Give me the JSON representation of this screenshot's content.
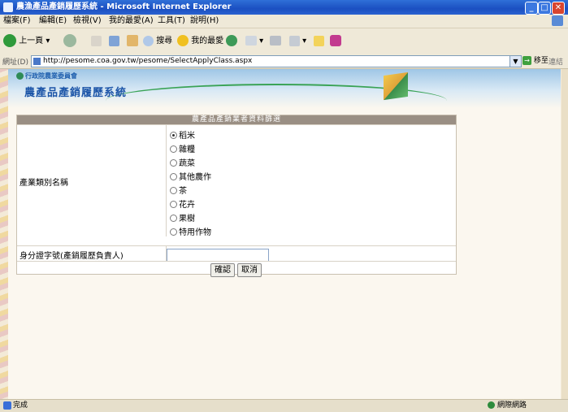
{
  "window": {
    "title": "農漁產品產銷履歷系統 - Microsoft Internet Explorer"
  },
  "menu": {
    "items": [
      "檔案(F)",
      "編輯(E)",
      "檢視(V)",
      "我的最愛(A)",
      "工具(T)",
      "說明(H)"
    ]
  },
  "toolbar": {
    "back_label": "上一頁",
    "search_label": "搜尋",
    "favorites_label": "我的最愛"
  },
  "address": {
    "label": "網址(D)",
    "url": "http://pesome.coa.gov.tw/pesome/SelectApplyClass.aspx",
    "go_label": "移至",
    "links_label": "連結"
  },
  "banner": {
    "org_name": "行政院農業委員會",
    "system_name": "農產品產銷履歷系統"
  },
  "form": {
    "header": "農產品產銷業者資料篩選",
    "category_label": "產業類別名稱",
    "options": [
      "稻米",
      "雜糧",
      "蔬菜",
      "其他農作",
      "茶",
      "花卉",
      "果樹",
      "特用作物"
    ],
    "selected_index": 0,
    "id_label": "身分證字號(產銷履歷負責人)",
    "id_value": "",
    "confirm_label": "確認",
    "cancel_label": "取消"
  },
  "status": {
    "left_text": "完成",
    "zone_text": "網際網路"
  }
}
